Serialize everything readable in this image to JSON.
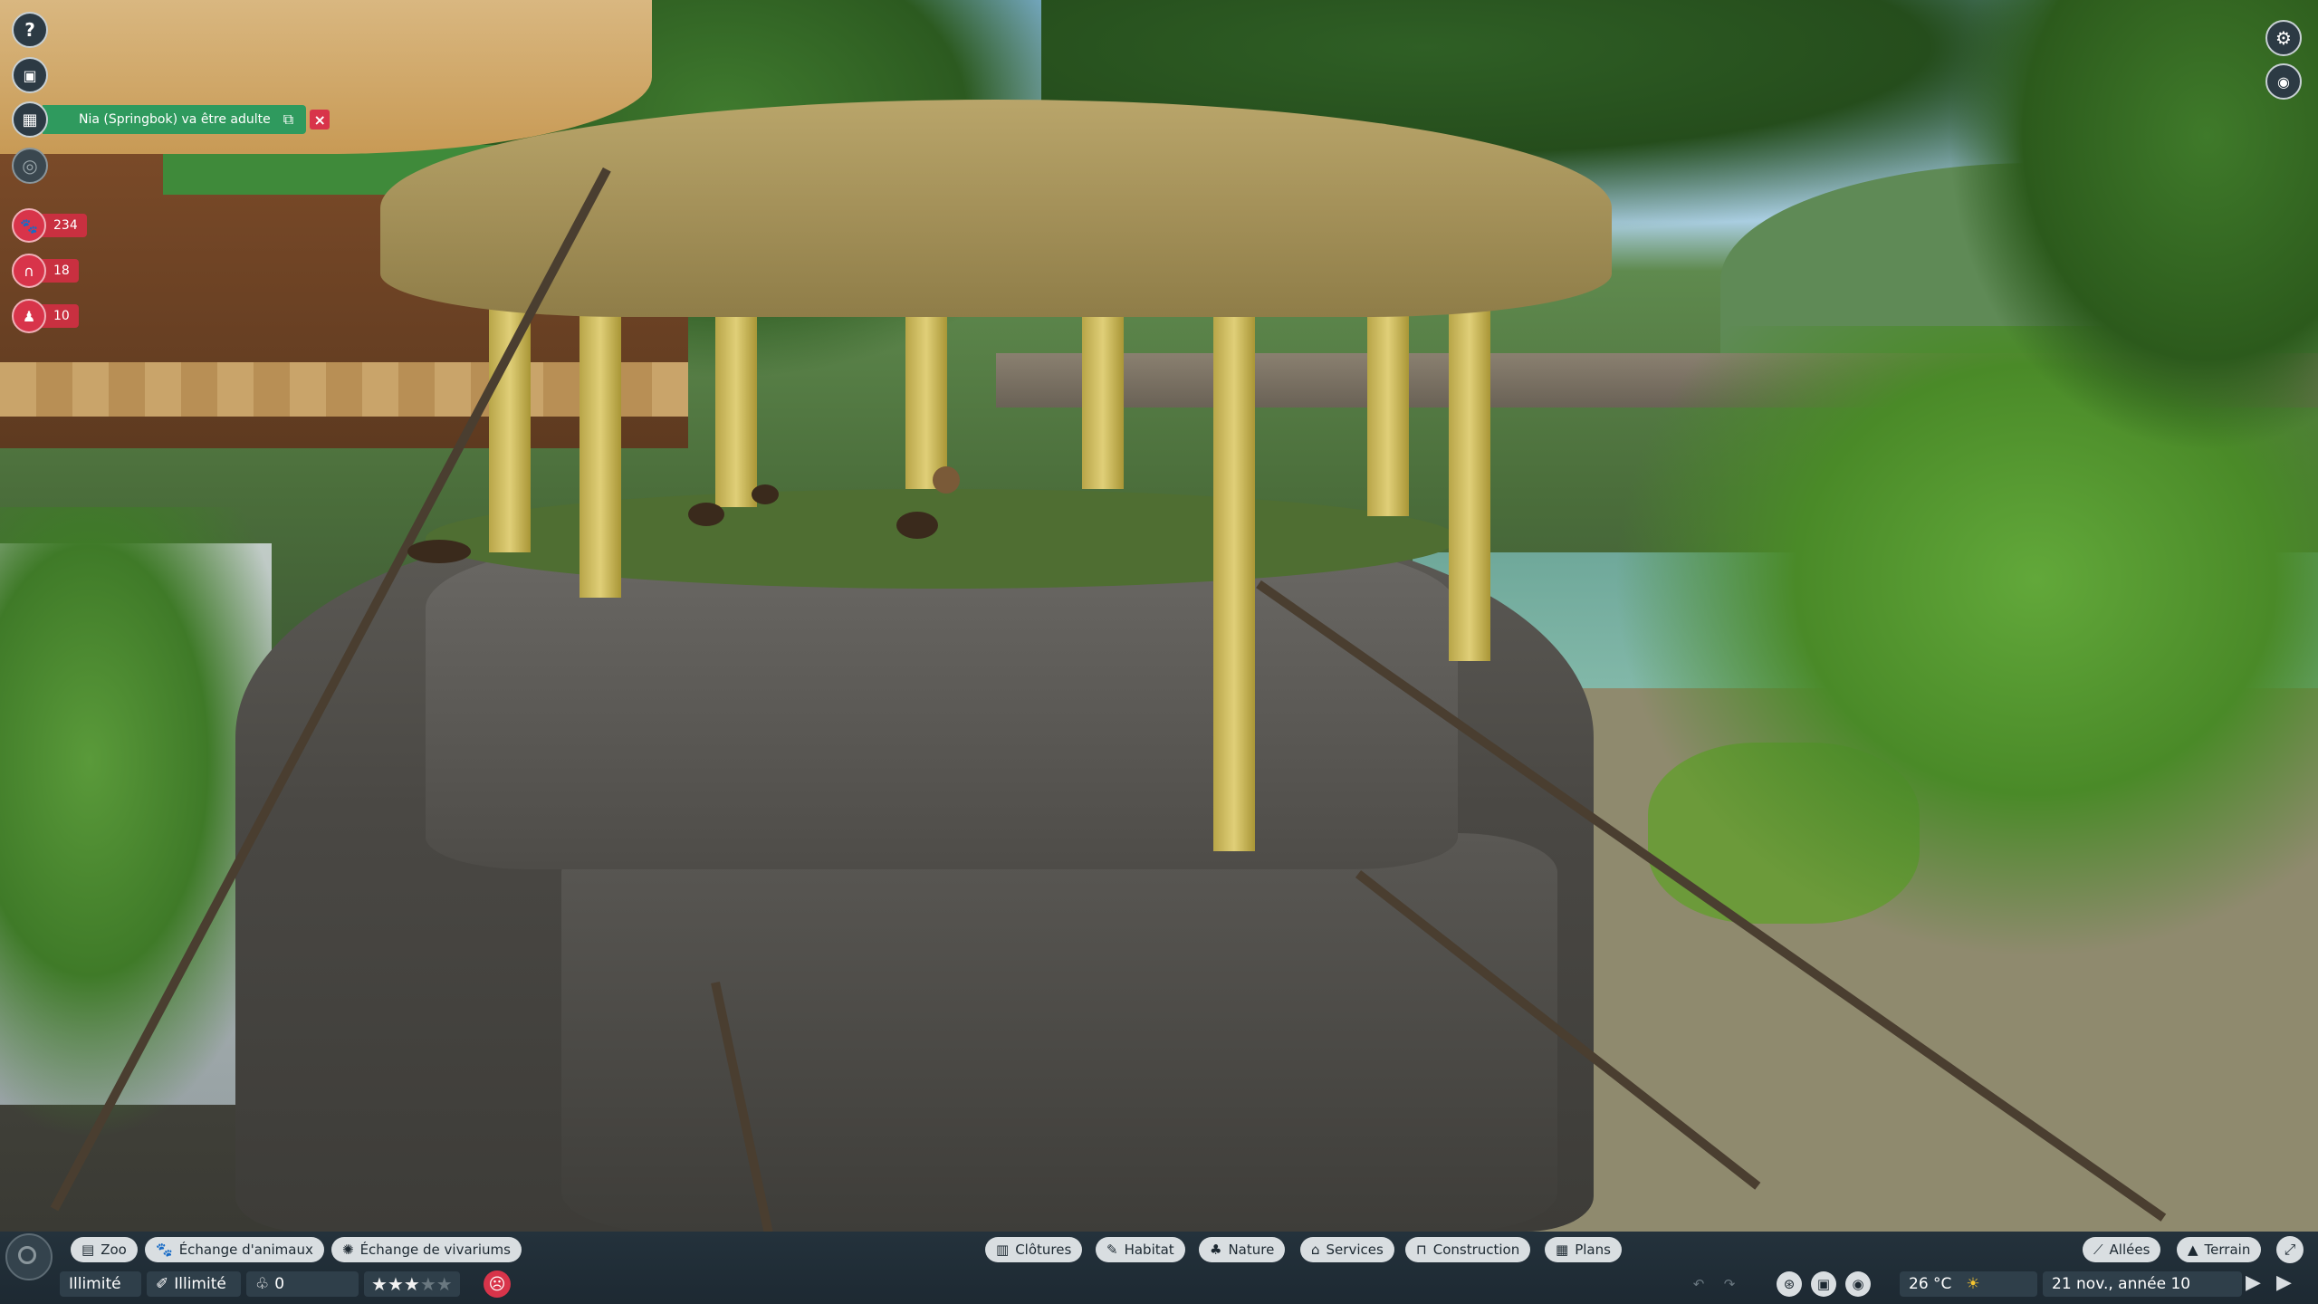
{
  "notification": {
    "text": "Nia (Springbok) va être adulte",
    "jump_icon": "external-link-icon",
    "close_icon": "close-icon"
  },
  "left_toolbar": {
    "help": "?",
    "stats": [
      {
        "icon": "paw-icon",
        "value": "234"
      },
      {
        "icon": "guest-icon",
        "value": "18"
      },
      {
        "icon": "staff-icon",
        "value": "10"
      }
    ]
  },
  "right_toolbar": {
    "settings_icon": "gear-icon",
    "camera_icon": "camera-icon"
  },
  "bottom_bar": {
    "left_tabs": [
      {
        "label": "Zoo",
        "icon": "zoo-icon"
      },
      {
        "label": "Échange d'animaux",
        "icon": "animal-trade-icon"
      },
      {
        "label": "Échange de vivariums",
        "icon": "vivarium-trade-icon"
      }
    ],
    "center_tabs": [
      {
        "label": "Clôtures",
        "icon": "fence-icon"
      },
      {
        "label": "Habitat",
        "icon": "habitat-icon"
      },
      {
        "label": "Nature",
        "icon": "nature-icon"
      },
      {
        "label": "Services",
        "icon": "services-icon"
      },
      {
        "label": "Construction",
        "icon": "construction-icon"
      },
      {
        "label": "Plans",
        "icon": "blueprint-icon"
      }
    ],
    "right_tabs": [
      {
        "label": "Allées",
        "icon": "paths-icon"
      },
      {
        "label": "Terrain",
        "icon": "terrain-icon"
      }
    ],
    "money": "Illimité",
    "research": "Illimité",
    "conservation": "0",
    "rating": 3,
    "rating_max": 5,
    "temperature": "26 °C",
    "weather_icon": "sun-icon",
    "date": "21 nov., année 10"
  }
}
